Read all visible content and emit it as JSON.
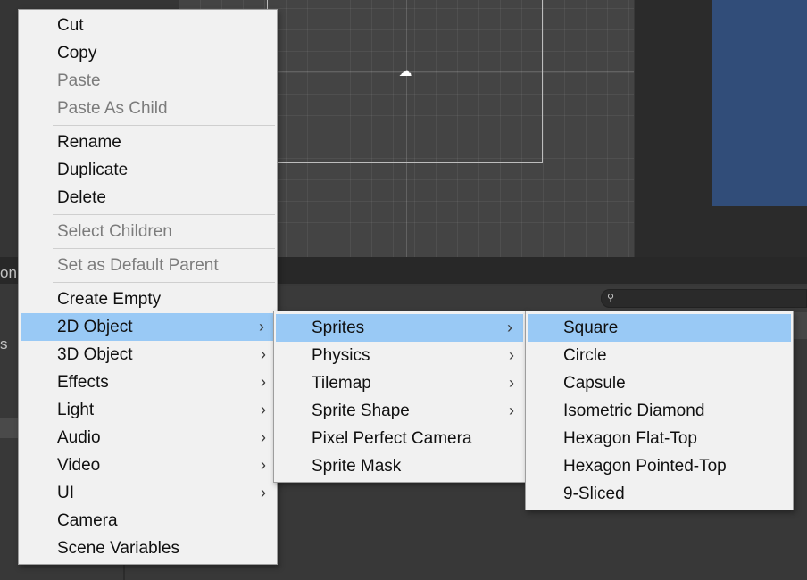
{
  "background": {
    "panel_tab_label": "on",
    "lower_left_label": "s"
  },
  "main_menu": {
    "items": [
      {
        "label": "Cut",
        "enabled": true
      },
      {
        "label": "Copy",
        "enabled": true
      },
      {
        "label": "Paste",
        "enabled": false
      },
      {
        "label": "Paste As Child",
        "enabled": false
      },
      {
        "label": "Rename",
        "enabled": true
      },
      {
        "label": "Duplicate",
        "enabled": true
      },
      {
        "label": "Delete",
        "enabled": true
      },
      {
        "label": "Select Children",
        "enabled": false
      },
      {
        "label": "Set as Default Parent",
        "enabled": false
      },
      {
        "label": "Create Empty",
        "enabled": true
      },
      {
        "label": "2D Object",
        "enabled": true,
        "submenu": true,
        "highlighted": true
      },
      {
        "label": "3D Object",
        "enabled": true,
        "submenu": true
      },
      {
        "label": "Effects",
        "enabled": true,
        "submenu": true
      },
      {
        "label": "Light",
        "enabled": true,
        "submenu": true
      },
      {
        "label": "Audio",
        "enabled": true,
        "submenu": true
      },
      {
        "label": "Video",
        "enabled": true,
        "submenu": true
      },
      {
        "label": "UI",
        "enabled": true,
        "submenu": true
      },
      {
        "label": "Camera",
        "enabled": true
      },
      {
        "label": "Scene Variables",
        "enabled": true
      }
    ]
  },
  "object_2d_menu": {
    "items": [
      {
        "label": "Sprites",
        "submenu": true,
        "highlighted": true
      },
      {
        "label": "Physics",
        "submenu": true
      },
      {
        "label": "Tilemap",
        "submenu": true
      },
      {
        "label": "Sprite Shape",
        "submenu": true
      },
      {
        "label": "Pixel Perfect Camera"
      },
      {
        "label": "Sprite Mask"
      }
    ]
  },
  "sprites_menu": {
    "items": [
      {
        "label": "Square",
        "highlighted": true
      },
      {
        "label": "Circle"
      },
      {
        "label": "Capsule"
      },
      {
        "label": "Isometric Diamond"
      },
      {
        "label": "Hexagon Flat-Top"
      },
      {
        "label": "Hexagon Pointed-Top"
      },
      {
        "label": "9-Sliced"
      }
    ]
  },
  "icons": {
    "chevron": "›",
    "search": "🔍",
    "camera_gizmo": "☁"
  },
  "colors": {
    "menu_bg": "#f1f1f1",
    "highlight": "#99c9f5",
    "disabled_text": "#7c7c7c",
    "game_view": "#314d79"
  }
}
